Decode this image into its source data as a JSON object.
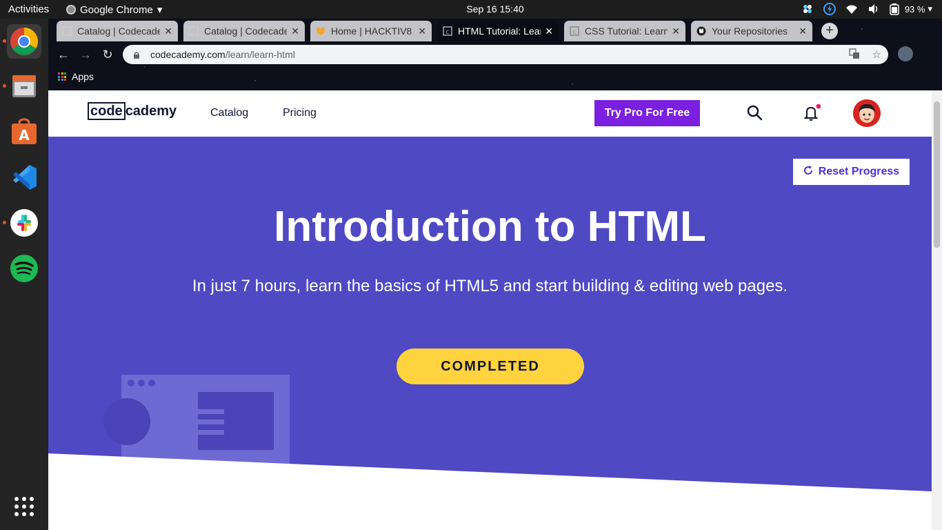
{
  "system": {
    "activities": "Activities",
    "app_name": "Google Chrome",
    "clock": "Sep 16  15:40",
    "battery": "93 %"
  },
  "browser": {
    "tabs": [
      {
        "title": "Catalog | Codecademy",
        "active": false
      },
      {
        "title": "Catalog | Codecademy",
        "active": false
      },
      {
        "title": "Home | HACKTIV8",
        "active": false
      },
      {
        "title": "HTML Tutorial: Learn",
        "active": true
      },
      {
        "title": "CSS Tutorial: Learn",
        "active": false
      },
      {
        "title": "Your Repositories",
        "active": false
      }
    ],
    "url_host": "codecademy.com",
    "url_path": "/learn/learn-html",
    "bookmarks_apps": "Apps"
  },
  "site": {
    "logo_left": "code",
    "logo_right": "cademy",
    "nav": {
      "catalog": "Catalog",
      "pricing": "Pricing"
    },
    "try_pro": "Try Pro For Free"
  },
  "hero": {
    "reset": "Reset Progress",
    "title": "Introduction to HTML",
    "subtitle": "In just 7 hours, learn the basics of HTML5 and start building & editing web pages.",
    "status": "COMPLETED"
  },
  "colors": {
    "hero_bg": "#4f49c4",
    "pro_button": "#7b1fe0",
    "completed_button": "#ffd33d"
  }
}
